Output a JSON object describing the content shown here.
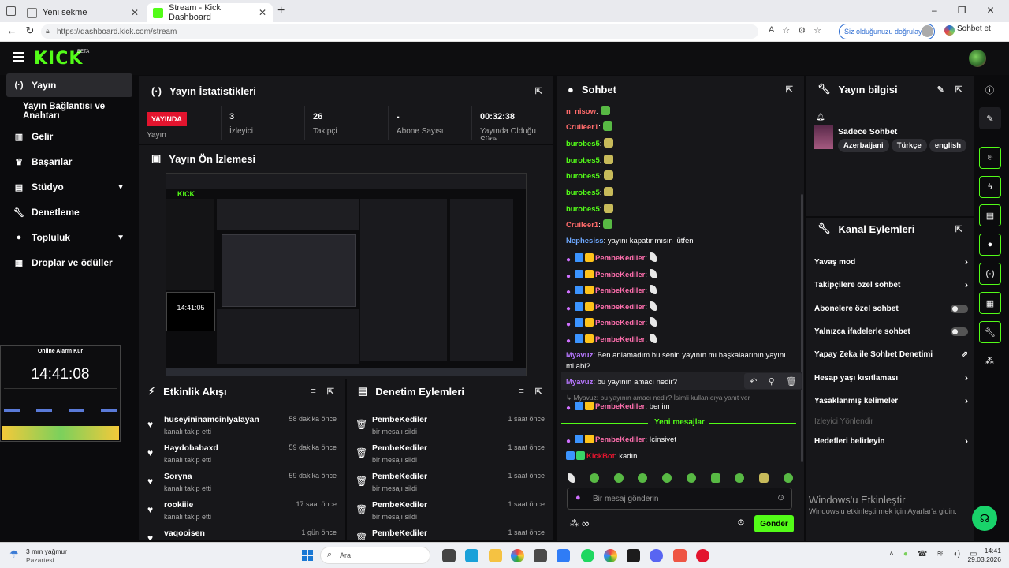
{
  "browser": {
    "tabs": [
      {
        "title": "Yeni sekme",
        "active": false
      },
      {
        "title": "Stream - Kick Dashboard",
        "active": true
      }
    ],
    "url": "https://dashboard.kick.com/stream",
    "verify_label": "Siz olduğunuzu doğrulayın",
    "chat_label": "Sohbet et"
  },
  "app": {
    "logo": "KICK",
    "beta": "BETA",
    "accent": "#53fc18"
  },
  "sidebar": {
    "items": [
      {
        "label": "Yayın",
        "icon": "broadcast-icon",
        "active": true
      },
      {
        "label": "Yayın Bağlantısı ve Anahtarı",
        "icon": "",
        "active": false
      },
      {
        "label": "Gelir",
        "icon": "chart-icon",
        "active": false
      },
      {
        "label": "Başarılar",
        "icon": "trophy-icon",
        "active": false
      },
      {
        "label": "Stüdyo",
        "icon": "studio-icon",
        "active": false,
        "expandable": true
      },
      {
        "label": "Denetleme",
        "icon": "wrench-icon",
        "active": false
      },
      {
        "label": "Topluluk",
        "icon": "community-icon",
        "active": false,
        "expandable": true
      },
      {
        "label": "Droplar ve ödüller",
        "icon": "gift-icon",
        "active": false
      }
    ]
  },
  "stats": {
    "title": "Yayın İstatistikleri",
    "live_badge": "YAYINDA",
    "live_label": "Yayın",
    "items": [
      {
        "value": "3",
        "label": "İzleyici"
      },
      {
        "value": "26",
        "label": "Takipçi"
      },
      {
        "value": "-",
        "label": "Abone Sayısı"
      },
      {
        "value": "00:32:38",
        "label": "Yayında Olduğu Süre"
      }
    ]
  },
  "preview": {
    "title": "Yayın Ön İzlemesi",
    "inner_clock": "14:41:05"
  },
  "activity": {
    "title": "Etkinlik Akışı",
    "items": [
      {
        "name": "huseyininamcinlyalayan",
        "sub": "kanalı takip etti",
        "time": "58 dakika önce"
      },
      {
        "name": "Haydobabaxd",
        "sub": "kanalı takip etti",
        "time": "59 dakika önce"
      },
      {
        "name": "Soryna",
        "sub": "kanalı takip etti",
        "time": "59 dakika önce"
      },
      {
        "name": "rookiiie",
        "sub": "kanalı takip etti",
        "time": "17 saat önce"
      },
      {
        "name": "vaqooisen",
        "sub": "",
        "time": "1 gün önce"
      }
    ]
  },
  "moderation": {
    "title": "Denetim Eylemleri",
    "items": [
      {
        "name": "PembeKediler",
        "sub": "bir mesajı sildi",
        "time": "1 saat önce"
      },
      {
        "name": "PembeKediler",
        "sub": "bir mesajı sildi",
        "time": "1 saat önce"
      },
      {
        "name": "PembeKediler",
        "sub": "bir mesajı sildi",
        "time": "1 saat önce"
      },
      {
        "name": "PembeKediler",
        "sub": "bir mesajı sildi",
        "time": "1 saat önce"
      },
      {
        "name": "PembeKediler",
        "sub": "",
        "time": "1 saat önce"
      }
    ]
  },
  "chat": {
    "title": "Sohbet",
    "messages": [
      {
        "user": "n_nisow",
        "color": "#ff6b6b",
        "text": ""
      },
      {
        "user": "Cruileer1",
        "color": "#ff6b6b",
        "text": ""
      },
      {
        "user": "burobes5",
        "color": "#53fc18",
        "text": ""
      },
      {
        "user": "burobes5",
        "color": "#53fc18",
        "text": ""
      },
      {
        "user": "burobes5",
        "color": "#53fc18",
        "text": ""
      },
      {
        "user": "burobes5",
        "color": "#53fc18",
        "text": ""
      },
      {
        "user": "burobes5",
        "color": "#53fc18",
        "text": ""
      },
      {
        "user": "Cruileer1",
        "color": "#ff6b6b",
        "text": ""
      },
      {
        "user": "Nephesiss",
        "color": "#6ea8ff",
        "text": "yayını kapatır mısın lütfen"
      },
      {
        "user": "PembeKediler",
        "color": "#ff6fae",
        "text": ""
      },
      {
        "user": "PembeKediler",
        "color": "#ff6fae",
        "text": ""
      },
      {
        "user": "PembeKediler",
        "color": "#ff6fae",
        "text": ""
      },
      {
        "user": "PembeKediler",
        "color": "#ff6fae",
        "text": ""
      },
      {
        "user": "PembeKediler",
        "color": "#ff6fae",
        "text": ""
      },
      {
        "user": "PembeKediler",
        "color": "#ff6fae",
        "text": ""
      },
      {
        "user": "Myavuz",
        "color": "#b777ff",
        "text": "Ben anlamadım bu senin yayının mı başkalaarının yayını mi abi?"
      },
      {
        "user": "Myavuz",
        "color": "#b777ff",
        "text": "bu yayının amacı nedir?"
      },
      {
        "user": "PembeKediler",
        "color": "#ff6fae",
        "text": "benim"
      },
      {
        "user": "PembeKediler",
        "color": "#ff6fae",
        "text": "Icinsiyet"
      },
      {
        "user": "KickBot",
        "color": "#e3142e",
        "text": "kadın"
      }
    ],
    "reply_hint": "Myavuz: bu yayının amacı nedir? İsimli kullanıcıya yanıt ver",
    "new_messages": "Yeni mesajlar",
    "input_placeholder": "Bir mesaj gönderin",
    "send_label": "Gönder"
  },
  "stream_info": {
    "title": "Yayın bilgisi",
    "stream_title": "Sadece Sohbet",
    "tags": [
      "Azerbaijani",
      "Türkçe",
      "english"
    ]
  },
  "channel_actions": {
    "title": "Kanal Eylemleri",
    "items": [
      {
        "label": "Yavaş mod",
        "control": "chevron"
      },
      {
        "label": "Takipçilere özel sohbet",
        "control": "chevron"
      },
      {
        "label": "Abonelere özel sohbet",
        "control": "toggle"
      },
      {
        "label": "Yalnızca ifadelerle sohbet",
        "control": "toggle"
      },
      {
        "label": "Yapay Zeka ile Sohbet Denetimi",
        "control": "external"
      },
      {
        "label": "Hesap yaşı kısıtlaması",
        "control": "chevron"
      },
      {
        "label": "Yasaklanmış kelimeler",
        "control": "chevron"
      },
      {
        "label": "İzleyici Yönlendir",
        "control": "none",
        "disabled": true
      },
      {
        "label": "Hedefleri belirleyin",
        "control": "chevron"
      }
    ]
  },
  "overlay": {
    "title": "Online Alarm Kur",
    "clock": "14:41:08"
  },
  "watermark": {
    "title": "Windows'u Etkinleştir",
    "sub": "Windows'u etkinleştirmek için Ayarlar'a gidin."
  },
  "taskbar": {
    "weather": "3 mm yağmur",
    "weather_sub": "Pazartesi",
    "search": "Ara",
    "time": "14:41",
    "date": "29.03.2026"
  }
}
